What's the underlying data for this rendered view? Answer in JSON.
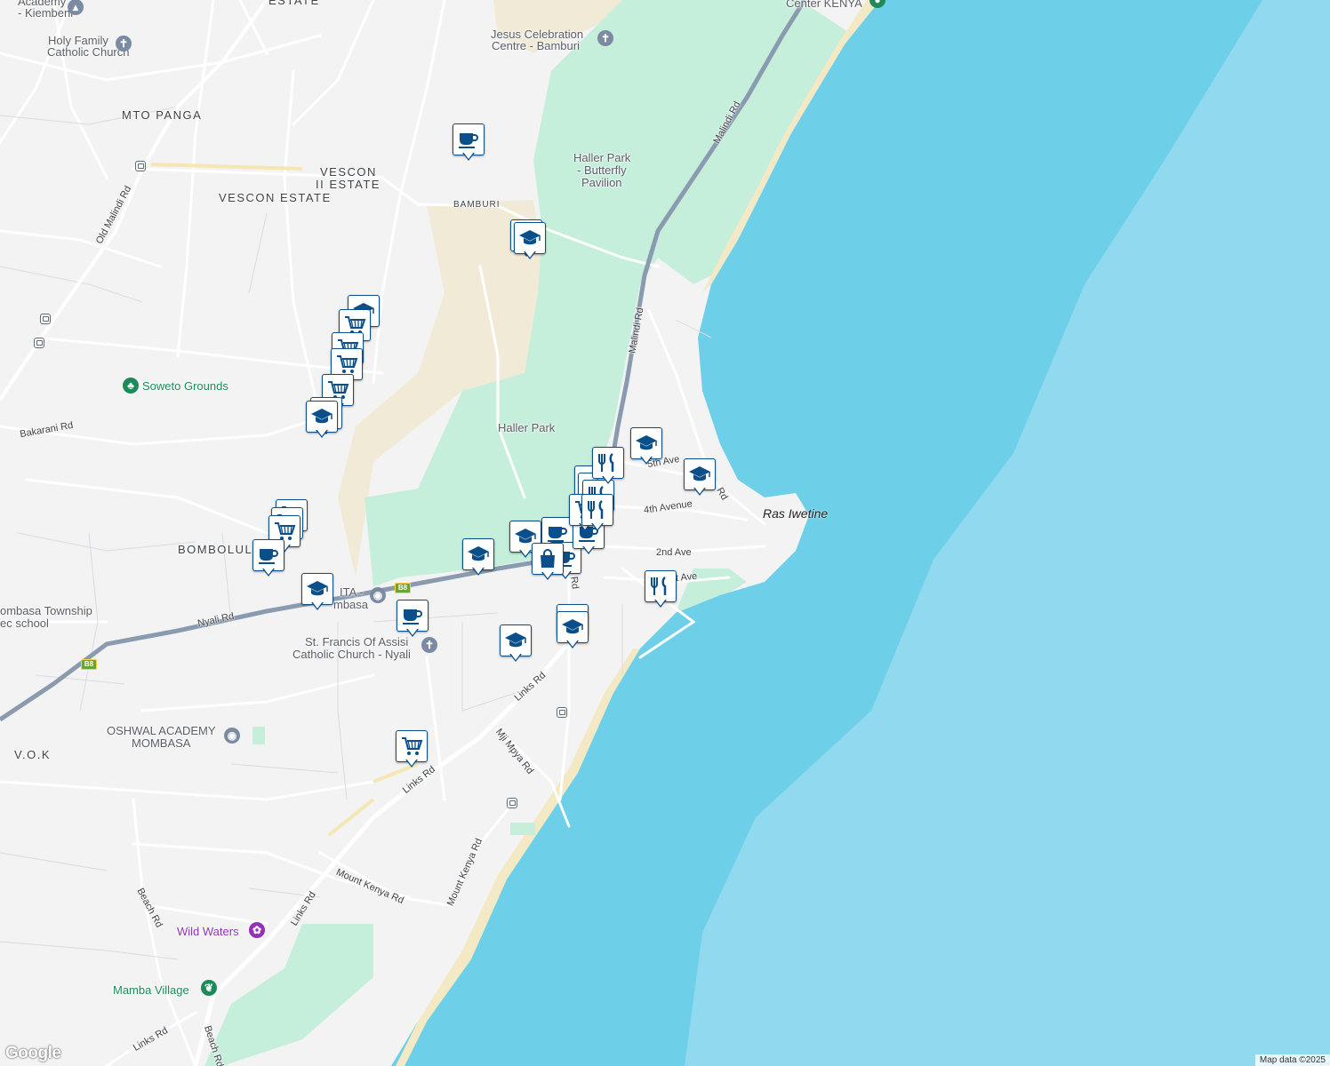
{
  "map": {
    "colors": {
      "land": "#f3f3f4",
      "sea_near": "#6ecfe9",
      "sea_far": "#90d9ef",
      "park": "#c5eedb",
      "sand": "#f1ead6",
      "major_road": "#8a9bb0",
      "pin_border": "#0b4f8a",
      "pin_icon": "#0b4f8a",
      "green_poi": "#1e8a5a",
      "purple_poi": "#9332b8"
    },
    "area_labels": {
      "estate_top": "ESTATE",
      "mto_panga": "MTO PANGA",
      "vescon_ii": "VESCON",
      "vescon_ii_b": "II ESTATE",
      "vescon_estate": "VESCON ESTATE",
      "bamburi": "BAMBURI",
      "bombolulu": "BOMBOLULU",
      "vok": "V.O.K"
    },
    "poi_labels": {
      "academy_1": "Academy",
      "academy_2": "- Kiembeni",
      "holy_family_1": "Holy Family",
      "holy_family_2": "Catholic Church",
      "jesus_1": "Jesus Celebration",
      "jesus_2": "Centre - Bamburi",
      "center_kenya": "Center KENYA",
      "haller_butterfly_1": "Haller Park",
      "haller_butterfly_2": "- Butterfly",
      "haller_butterfly_3": "Pavilion",
      "haller_park": "Haller Park",
      "soweto": "Soweto Grounds",
      "ita_1": "ITA -",
      "ita_2": "mbasa",
      "mombasa_township_1": "ombasa Township",
      "mombasa_township_2": "ec school",
      "st_francis_1": "St. Francis Of Assisi",
      "st_francis_2": "Catholic Church - Nyali",
      "oshwal_1": "OSHWAL ACADEMY",
      "oshwal_2": "MOMBASA",
      "wild_waters": "Wild Waters",
      "mamba_village": "Mamba Village",
      "ras_iwetine": "Ras Iwetine"
    },
    "road_labels": {
      "malindi_rd_1": "Malindi Rd",
      "malindi_rd_2": "Malindi Rd",
      "old_malindi_rd": "Old Malindi Rd",
      "bakarani_rd": "Bakarani Rd",
      "nyali_rd": "Nyali Rd",
      "links_rd_1": "Links Rd",
      "links_rd_2": "Links Rd",
      "links_rd_3": "Links Rd",
      "links_rd_4": "Links Rd",
      "mji_mpya_rd": "Mji Mpya Rd",
      "mount_kenya_rd_1": "Mount Kenya Rd",
      "mount_kenya_rd_2": "Mount Kenya Rd",
      "beach_rd_1": "Beach Rd",
      "beach_rd_2": "Beach Rd",
      "fourth_ave": "4th Avenue",
      "second_ave": "2nd Ave",
      "first_ave": "t Ave",
      "fifth_ave": "5th Ave",
      "rd_near_shops": "Rd",
      "rd_ras": "Rd"
    },
    "route_shield": "B8",
    "attribution": "Map data ©2025",
    "logo": "Google"
  }
}
